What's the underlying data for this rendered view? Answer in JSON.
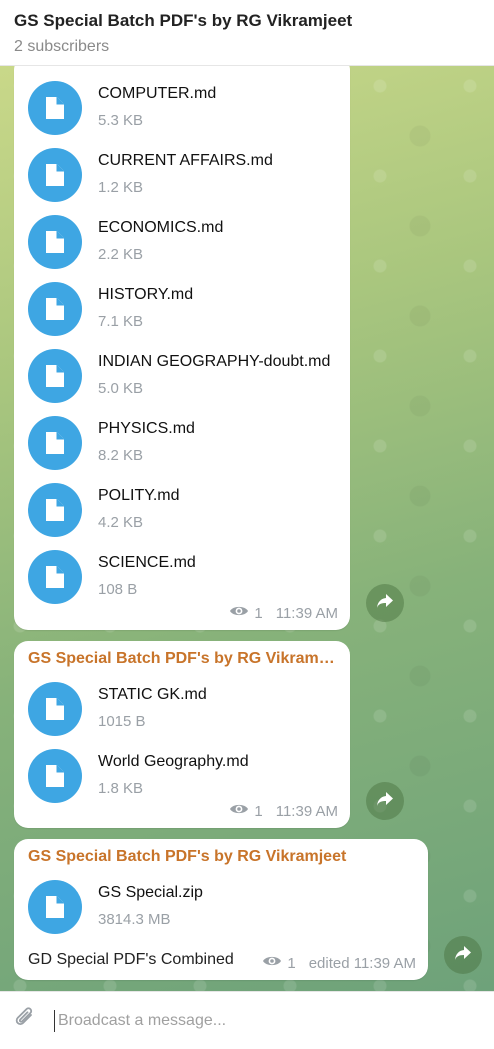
{
  "header": {
    "title": "GS Special Batch PDF's by RG Vikramjeet",
    "subtitle": "2 subscribers"
  },
  "messages": [
    {
      "files": [
        {
          "name": "COMPUTER.md",
          "size": "5.3 KB"
        },
        {
          "name": "CURRENT AFFAIRS.md",
          "size": "1.2 KB"
        },
        {
          "name": "ECONOMICS.md",
          "size": "2.2 KB"
        },
        {
          "name": "HISTORY.md",
          "size": "7.1 KB"
        },
        {
          "name": "INDIAN GEOGRAPHY-doubt.md",
          "size": "5.0 KB"
        },
        {
          "name": "PHYSICS.md",
          "size": "8.2 KB"
        },
        {
          "name": "POLITY.md",
          "size": "4.2 KB"
        },
        {
          "name": "SCIENCE.md",
          "size": "108 B"
        }
      ],
      "views": "1",
      "time": "11:39 AM"
    },
    {
      "sender": "GS Special Batch PDF's by RG Vikramje...",
      "files": [
        {
          "name": "STATIC GK.md",
          "size": "1015 B"
        },
        {
          "name": "World Geography.md",
          "size": "1.8 KB"
        }
      ],
      "views": "1",
      "time": "11:39 AM"
    },
    {
      "sender": "GS Special Batch PDF's by RG Vikramjeet",
      "files": [
        {
          "name": "GS Special.zip",
          "size": "3814.3 MB"
        }
      ],
      "caption": "GD Special PDF's Combined",
      "views": "1",
      "time": "edited 11:39 AM"
    }
  ],
  "composer": {
    "placeholder": "Broadcast a message..."
  },
  "colors": {
    "accent": "#3ea6e3",
    "sender": "#c8742a"
  }
}
